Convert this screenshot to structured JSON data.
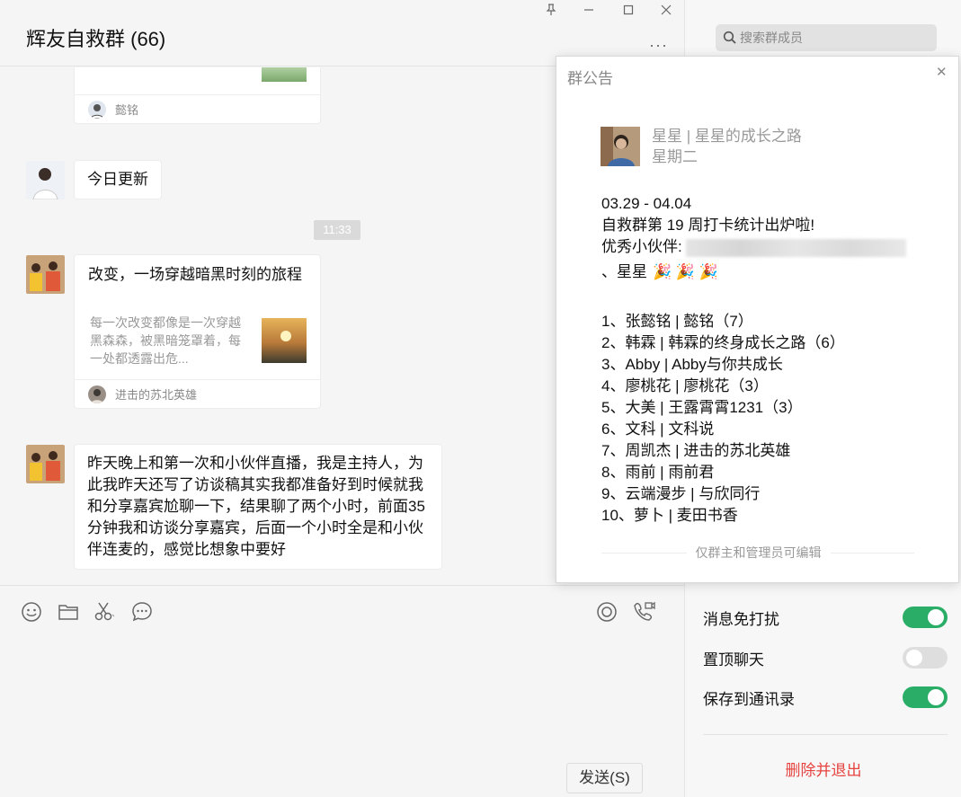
{
  "chat": {
    "title": "辉友自救群 (66)",
    "window_buttons": {
      "pin": "pin-icon",
      "minimize": "minimize-icon",
      "maximize": "maximize-icon",
      "close": "close-icon"
    },
    "more": "···",
    "messages": [
      {
        "type": "card-partial",
        "source": "懿铭"
      },
      {
        "type": "text",
        "text": "今日更新"
      },
      {
        "type": "timestamp",
        "text": "11:33"
      },
      {
        "type": "card",
        "title": "改变，一场穿越暗黑时刻的旅程",
        "desc": "每一次改变都像是一次穿越黑森森，被黑暗笼罩着，每一处都透露出危...",
        "source": "进击的苏北英雄"
      },
      {
        "type": "text",
        "text": "昨天晚上和第一次和小伙伴直播，我是主持人，为此我昨天还写了访谈稿其实我都准备好到时候就我和分享嘉宾尬聊一下，结果聊了两个小时，前面35分钟我和访谈分享嘉宾，后面一个小时全是和小伙伴连麦的，感觉比想象中要好"
      }
    ],
    "toolbar": [
      "emoji-icon",
      "folder-icon",
      "scissors-icon",
      "chat-bubble-icon",
      "live-icon",
      "video-call-icon"
    ],
    "send_label": "发送(S)"
  },
  "side": {
    "search_placeholder": "搜索群成员",
    "settings": [
      {
        "label": "消息免打扰",
        "on": true
      },
      {
        "label": "置顶聊天",
        "on": false
      },
      {
        "label": "保存到通讯录",
        "on": true
      }
    ],
    "leave_label": "删除并退出"
  },
  "announcement": {
    "title": "群公告",
    "author": "星星 | 星星的成长之路",
    "date": "星期二",
    "date_range": "03.29 - 04.04",
    "headline": "自救群第 19 周打卡统计出炉啦!",
    "excellent_label": "优秀小伙伴:",
    "excellent_tail": "、星星",
    "party": "🎉 🎉 🎉",
    "list": [
      "1、张懿铭 | 懿铭（7）",
      "2、韩霖 | 韩霖的终身成长之路（6）",
      "3、Abby | Abby与你共成长",
      "4、廖桃花 | 廖桃花（3）",
      "5、大美 | 王露霄霄1231（3）",
      "6、文科 | 文科说",
      "7、周凯杰 | 进击的苏北英雄",
      "8、雨前 | 雨前君",
      "9、云端漫步 |  与欣同行",
      "10、萝卜 | 麦田书香"
    ],
    "footer": "仅群主和管理员可编辑"
  }
}
